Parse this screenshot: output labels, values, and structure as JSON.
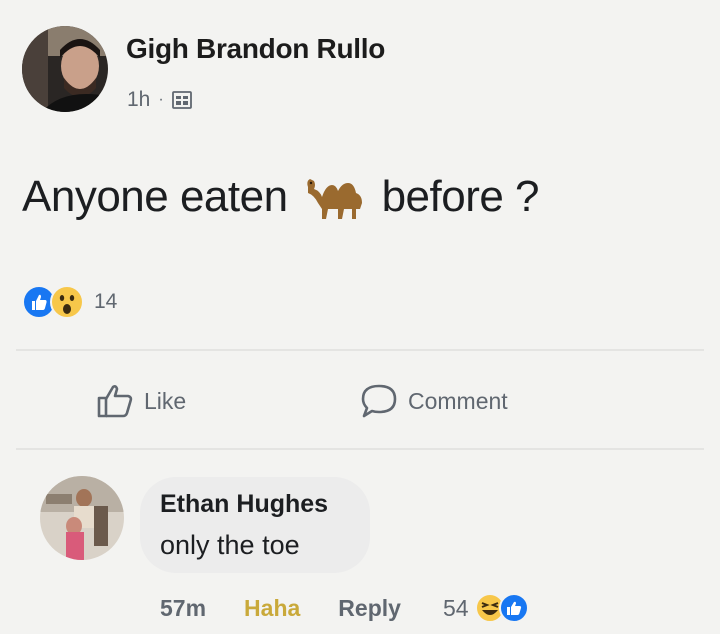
{
  "post": {
    "author": "Gigh Brandon Rullo",
    "time": "1h",
    "separator": "·",
    "privacy_icon": "friends-icon",
    "text_before": "Anyone eaten",
    "emoji": "camel-emoji",
    "text_after": "before ?",
    "reaction_icons": [
      "like-reaction-icon",
      "wow-reaction-icon"
    ],
    "reaction_count": "14"
  },
  "actions": {
    "like_label": "Like",
    "comment_label": "Comment"
  },
  "comment": {
    "author": "Ethan Hughes",
    "text": "only the toe",
    "time": "57m",
    "haha_label": "Haha",
    "reply_label": "Reply",
    "reaction_count": "54",
    "reaction_icons": [
      "haha-reaction-icon",
      "like-reaction-icon"
    ]
  },
  "colors": {
    "background": "#f3f3f1",
    "like_blue": "#1877f2",
    "haha_yellow": "#c9a93a",
    "bubble": "#ececec",
    "muted_text": "#606770"
  }
}
